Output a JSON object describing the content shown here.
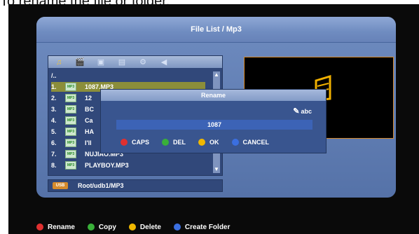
{
  "caption": "To rename the file or folder.",
  "window": {
    "title": "File List / Mp3"
  },
  "toolbar": {
    "icons": [
      "music-folder-icon",
      "movie-icon",
      "photo-icon",
      "film-icon",
      "settings-icon",
      "speaker-icon"
    ]
  },
  "filelist": {
    "parent": "/..",
    "items": [
      {
        "num": "1.",
        "type": "MP3",
        "name": "1087.MP3"
      },
      {
        "num": "2.",
        "type": "MP3",
        "name": "12"
      },
      {
        "num": "3.",
        "type": "MP3",
        "name": "BC"
      },
      {
        "num": "4.",
        "type": "MP3",
        "name": "Ca"
      },
      {
        "num": "5.",
        "type": "MP3",
        "name": "HA"
      },
      {
        "num": "6.",
        "type": "MP3",
        "name": "I'll"
      },
      {
        "num": "7.",
        "type": "MP3",
        "name": "NUJIAO.MP3"
      },
      {
        "num": "8.",
        "type": "MP3",
        "name": "PLAYBOY.MP3"
      }
    ]
  },
  "path": {
    "usb_label": "USB",
    "value": "Root/udb1/MP3"
  },
  "dialog": {
    "title": "Rename",
    "mode": "abc",
    "input_value": "1087",
    "buttons": [
      {
        "label": "CAPS",
        "color": "#e03030"
      },
      {
        "label": "DEL",
        "color": "#39b039"
      },
      {
        "label": "OK",
        "color": "#f0b800"
      },
      {
        "label": "CANCEL",
        "color": "#3b6fe0"
      }
    ]
  },
  "footer": [
    {
      "label": "Rename",
      "color": "#e03030"
    },
    {
      "label": "Copy",
      "color": "#39b039"
    },
    {
      "label": "Delete",
      "color": "#f0b800"
    },
    {
      "label": "Create Folder",
      "color": "#3b6fe0"
    }
  ]
}
